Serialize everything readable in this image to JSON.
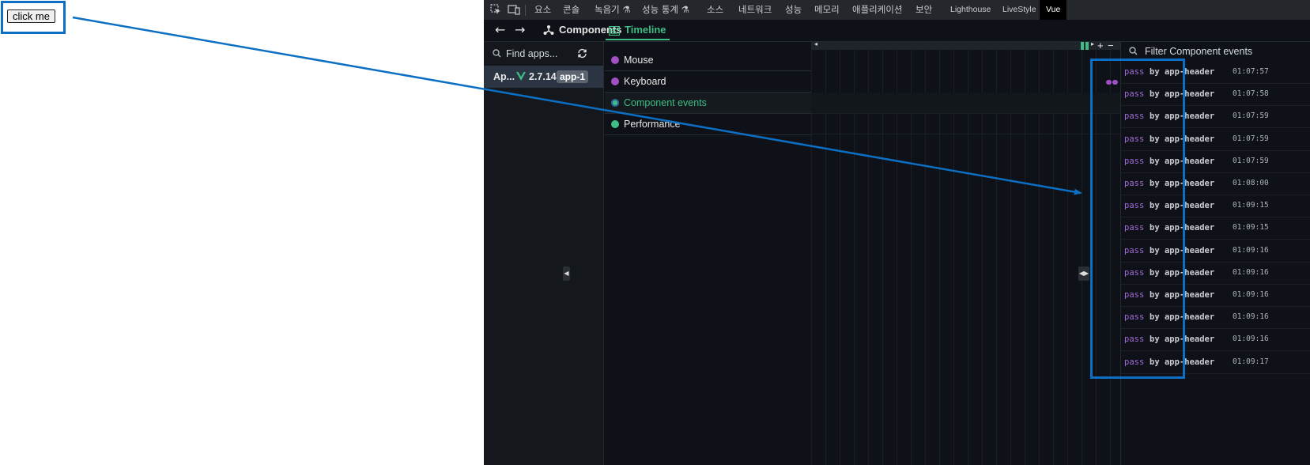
{
  "page": {
    "button_label": "click me"
  },
  "devtools": {
    "tabs": [
      "요소",
      "콘솔",
      "녹음기 ⚗",
      "성능 통계 ⚗",
      "소스",
      "네트워크",
      "성능",
      "메모리",
      "애플리케이션",
      "보안",
      "Lighthouse",
      "LiveStyle",
      "Vue"
    ],
    "active_tab": "Vue"
  },
  "vue": {
    "nav": {
      "back": "←",
      "forward": "→"
    },
    "tabs": {
      "components": "Components",
      "timeline": "Timeline"
    },
    "apps": {
      "search_placeholder": "Find apps...",
      "app": {
        "name": "Ap...",
        "version": "2.7.14",
        "id": "app-1"
      }
    },
    "layers": [
      "Mouse",
      "Keyboard",
      "Component events",
      "Performance"
    ],
    "layer_colors": [
      "#a251c4",
      "#a251c4",
      "#3ebd84",
      "#3ebd84"
    ],
    "controls": {
      "zoom_in": "+",
      "zoom_out": "−"
    },
    "events": {
      "filter_placeholder": "Filter Component events",
      "rows": [
        {
          "type": "pass",
          "source": "by app-header",
          "time": "01:07:57"
        },
        {
          "type": "pass",
          "source": "by app-header",
          "time": "01:07:58"
        },
        {
          "type": "pass",
          "source": "by app-header",
          "time": "01:07:59"
        },
        {
          "type": "pass",
          "source": "by app-header",
          "time": "01:07:59"
        },
        {
          "type": "pass",
          "source": "by app-header",
          "time": "01:07:59"
        },
        {
          "type": "pass",
          "source": "by app-header",
          "time": "01:08:00"
        },
        {
          "type": "pass",
          "source": "by app-header",
          "time": "01:09:15"
        },
        {
          "type": "pass",
          "source": "by app-header",
          "time": "01:09:15"
        },
        {
          "type": "pass",
          "source": "by app-header",
          "time": "01:09:16"
        },
        {
          "type": "pass",
          "source": "by app-header",
          "time": "01:09:16"
        },
        {
          "type": "pass",
          "source": "by app-header",
          "time": "01:09:16"
        },
        {
          "type": "pass",
          "source": "by app-header",
          "time": "01:09:16"
        },
        {
          "type": "pass",
          "source": "by app-header",
          "time": "01:09:16"
        },
        {
          "type": "pass",
          "source": "by app-header",
          "time": "01:09:17"
        }
      ]
    }
  },
  "annotation_color": "#0d6fc4"
}
